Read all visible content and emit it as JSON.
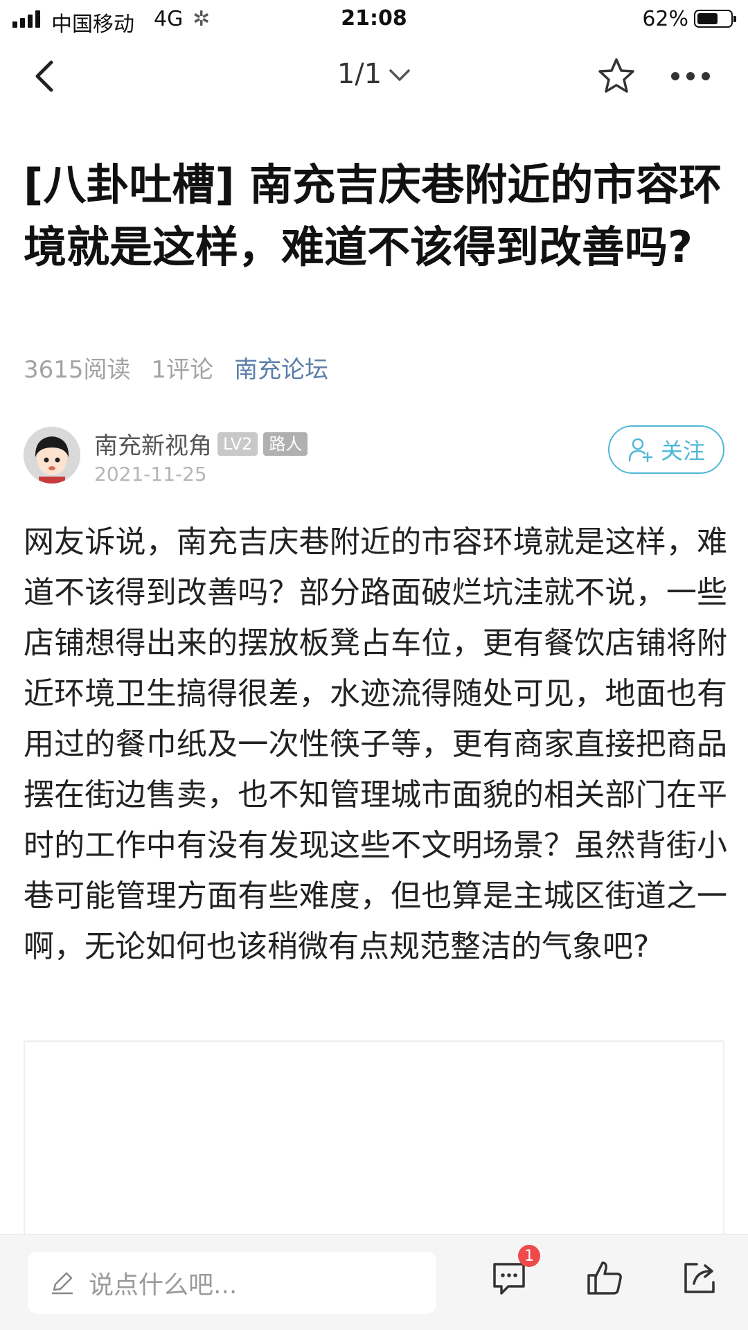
{
  "status_bar": {
    "carrier": "中国移动",
    "network": "4G",
    "loading_icon": "spinner-icon",
    "time": "21:08",
    "battery_percent": "62%",
    "battery_level": 0.62
  },
  "nav": {
    "back_icon": "chevron-left-icon",
    "page_indicator": "1/1",
    "dropdown_icon": "chevron-down-icon",
    "favorite_icon": "star-icon",
    "more_icon": "more-dots-icon"
  },
  "post": {
    "title": "[八卦吐槽] 南充吉庆巷附近的市容环境就是这样，难道不该得到改善吗?",
    "reads": "3615阅读",
    "comments": "1评论",
    "forum": "南充论坛",
    "body": "网友诉说，南充吉庆巷附近的市容环境就是这样，难道不该得到改善吗？部分路面破烂坑洼就不说，一些店铺想得出来的摆放板凳占车位，更有餐饮店铺将附近环境卫生搞得很差，水迹流得随处可见，地面也有用过的餐巾纸及一次性筷子等，更有商家直接把商品摆在街边售卖，也不知管理城市面貌的相关部门在平时的工作中有没有发现这些不文明场景？虽然背街小巷可能管理方面有些难度，但也算是主城区街道之一啊，无论如何也该稍微有点规范整洁的气象吧?"
  },
  "author": {
    "name": "南充新视角",
    "level_badge": "LV2",
    "role_badge": "路人",
    "date": "2021-11-25",
    "follow_label": "关注",
    "follow_icon": "add-user-icon"
  },
  "bottom_bar": {
    "input_placeholder": "说点什么吧...",
    "edit_icon": "pencil-icon",
    "comment_icon": "comment-icon",
    "comment_count": "1",
    "like_icon": "thumbs-up-icon",
    "share_icon": "share-icon"
  },
  "colors": {
    "accent": "#4fb8d6",
    "forum_link": "#5b7fa8",
    "badge_red": "#ef4a4a"
  }
}
